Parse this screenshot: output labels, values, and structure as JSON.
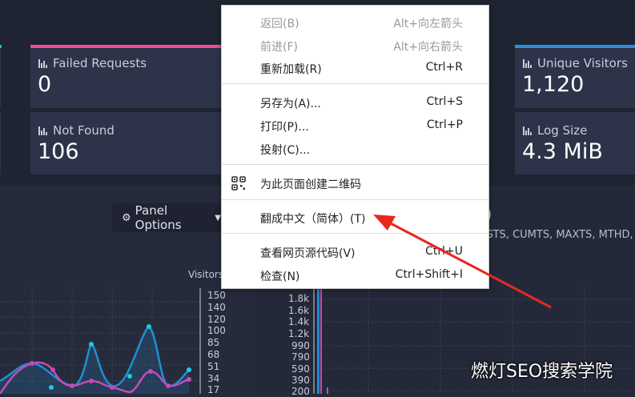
{
  "cards": {
    "failed_requests": {
      "title": "Failed Requests",
      "value": "0",
      "accent": "#ef4f8f"
    },
    "not_found": {
      "title": "Not Found",
      "value": "106"
    },
    "unique_visitors": {
      "title": "Unique Visitors",
      "value": "1,120",
      "accent": "#2a8fe0"
    },
    "log_size": {
      "title": "Log Size",
      "value": "4.3 MiB"
    }
  },
  "panel_options": {
    "label": "Panel Options"
  },
  "visitors_chart": {
    "title": "Visitors",
    "y_ticks": [
      "150",
      "140",
      "120",
      "100",
      "85",
      "68",
      "51",
      "34",
      "17"
    ]
  },
  "right_chart": {
    "header_fragment": ")",
    "columns_fragment": "GTS, CUMTS, MAXTS, MTHD, I",
    "y_ticks": [
      "1.8k",
      "1.6k",
      "1.4k",
      "1.2k",
      "990",
      "790",
      "590",
      "390",
      "200"
    ]
  },
  "context_menu": {
    "items": [
      {
        "label": "返回(B)",
        "shortcut": "Alt+向左箭头",
        "disabled": true
      },
      {
        "label": "前进(F)",
        "shortcut": "Alt+向右箭头",
        "disabled": true
      },
      {
        "label": "重新加载(R)",
        "shortcut": "Ctrl+R",
        "disabled": false
      },
      {
        "label": "另存为(A)...",
        "shortcut": "Ctrl+S",
        "disabled": false
      },
      {
        "label": "打印(P)...",
        "shortcut": "Ctrl+P",
        "disabled": false
      },
      {
        "label": "投射(C)...",
        "shortcut": "",
        "disabled": false
      },
      {
        "label": "为此页面创建二维码",
        "shortcut": "",
        "disabled": false
      },
      {
        "label": "翻成中文（简体）(T)",
        "shortcut": "",
        "disabled": false
      },
      {
        "label": "查看网页源代码(V)",
        "shortcut": "Ctrl+U",
        "disabled": false
      },
      {
        "label": "检查(N)",
        "shortcut": "Ctrl+Shift+I",
        "disabled": false
      }
    ]
  },
  "watermark": "燃灯SEO搜索学院"
}
